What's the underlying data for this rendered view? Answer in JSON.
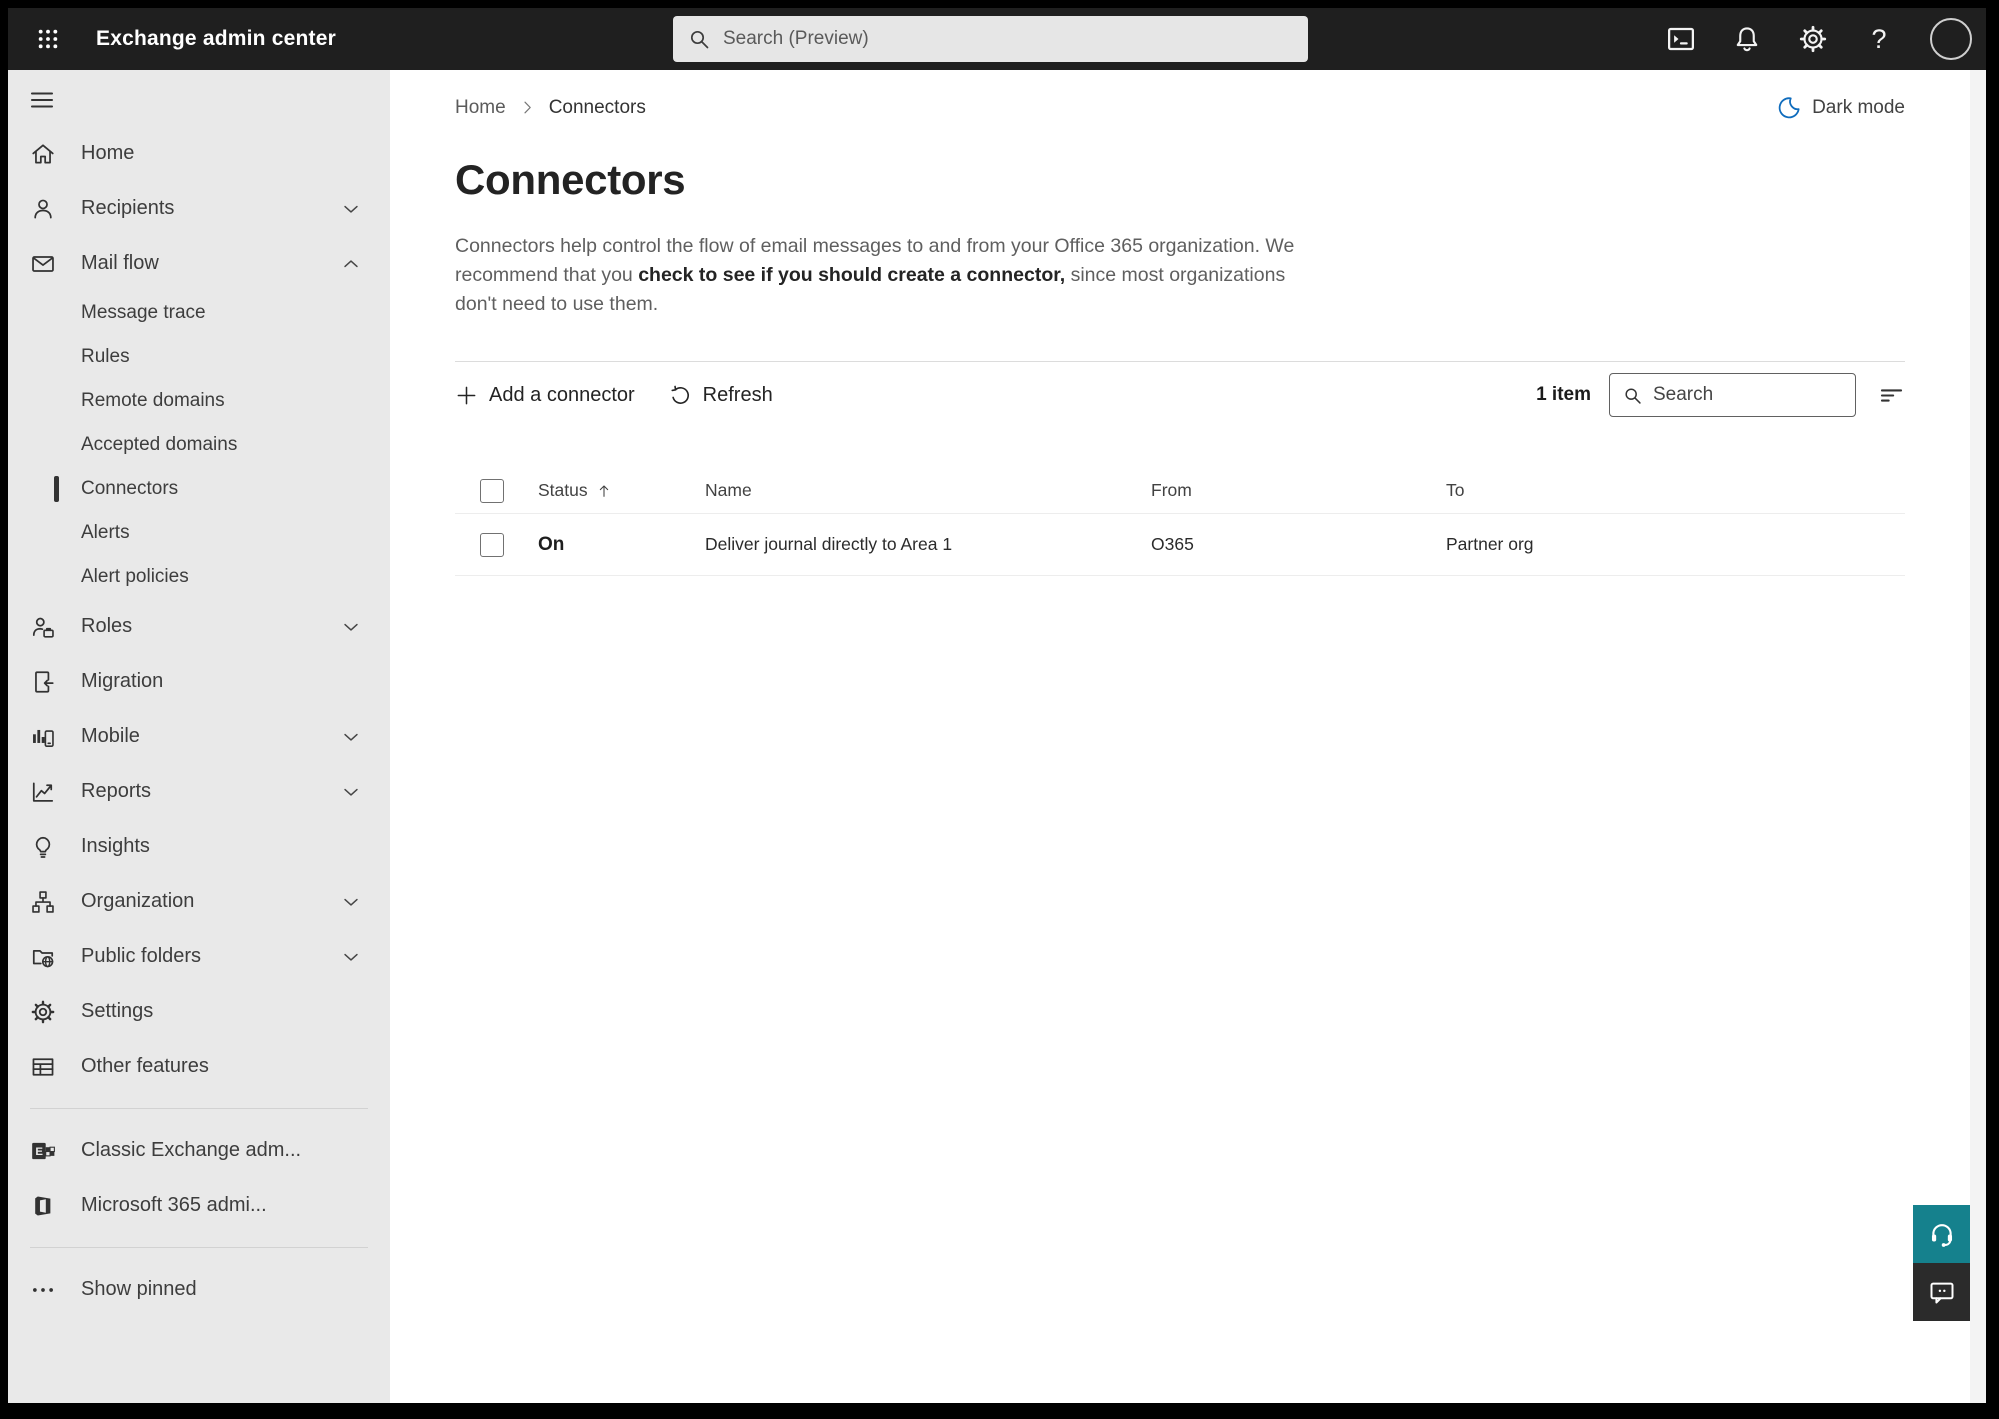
{
  "colors": {
    "topbar_bg": "#1f1f1f",
    "sidebar_bg": "#e9e9e9",
    "selection": "#333333",
    "moon": "#0f6cbd"
  },
  "topbar": {
    "app_launcher_icon": "waffle-icon",
    "title": "Exchange admin center",
    "search_placeholder": "Search (Preview)",
    "search_icon": "search-icon",
    "icons": [
      {
        "name": "terminal-icon"
      },
      {
        "name": "bell-icon"
      },
      {
        "name": "gear-icon"
      },
      {
        "name": "help-icon"
      },
      {
        "name": "avatar"
      }
    ]
  },
  "sidebar": {
    "menu_icon": "hamburger-icon",
    "items": [
      {
        "label": "Home",
        "icon": "home-icon"
      },
      {
        "label": "Recipients",
        "icon": "person-icon",
        "chevron": "down"
      },
      {
        "label": "Mail flow",
        "icon": "mail-icon",
        "chevron": "up"
      },
      {
        "label": "Message trace",
        "sub": true
      },
      {
        "label": "Rules",
        "sub": true
      },
      {
        "label": "Remote domains",
        "sub": true
      },
      {
        "label": "Accepted domains",
        "sub": true
      },
      {
        "label": "Connectors",
        "sub": true,
        "selected": true
      },
      {
        "label": "Alerts",
        "sub": true
      },
      {
        "label": "Alert policies",
        "sub": true
      },
      {
        "label": "Roles",
        "icon": "roles-icon",
        "chevron": "down"
      },
      {
        "label": "Migration",
        "icon": "migration-icon"
      },
      {
        "label": "Mobile",
        "icon": "mobile-icon",
        "chevron": "down"
      },
      {
        "label": "Reports",
        "icon": "reports-icon",
        "chevron": "down"
      },
      {
        "label": "Insights",
        "icon": "insights-icon"
      },
      {
        "label": "Organization",
        "icon": "organization-icon",
        "chevron": "down"
      },
      {
        "label": "Public folders",
        "icon": "public-folders-icon",
        "chevron": "down"
      },
      {
        "label": "Settings",
        "icon": "settings-icon"
      },
      {
        "label": "Other features",
        "icon": "other-features-icon"
      },
      {
        "divider": true
      },
      {
        "label": "Classic Exchange adm...",
        "icon": "classic-exchange-icon"
      },
      {
        "label": "Microsoft 365 admi...",
        "icon": "microsoft-365-icon"
      },
      {
        "divider": true
      },
      {
        "label": "Show pinned",
        "icon": "ellipsis-icon"
      }
    ]
  },
  "main": {
    "breadcrumb": [
      {
        "label": "Home"
      },
      {
        "label": "Connectors"
      }
    ],
    "breadcrumb_separator_icon": "chevron-right-icon",
    "dark_mode_icon": "moon-icon",
    "dark_mode_label": "Dark mode",
    "title": "Connectors",
    "description_part1": "Connectors help control the flow of email messages to and from your Office 365 organization. We recommend that you ",
    "description_emphasis": "check to see if you should create a connector,",
    "description_part2": " since most organizations don't need to use them.",
    "toolbar": {
      "add_icon": "plus-icon",
      "add_label": "Add a connector",
      "refresh_icon": "refresh-icon",
      "refresh_label": "Refresh",
      "item_count": "1 item",
      "search_icon": "search-icon",
      "search_placeholder": "Search",
      "filter_icon": "filter-icon"
    },
    "table": {
      "columns": [
        "Status",
        "Name",
        "From",
        "To"
      ],
      "sort_column": "Status",
      "sort_icon": "arrow-up-icon",
      "rows": [
        {
          "status": "On",
          "name": "Deliver journal directly to Area 1",
          "from": "O365",
          "to": "Partner org"
        }
      ]
    }
  },
  "floating_buttons": [
    {
      "name": "help-button",
      "icon": "headset-icon",
      "color": "#15818d"
    },
    {
      "name": "feedback-button",
      "icon": "comment-icon",
      "color": "#2b2b2b"
    }
  ]
}
